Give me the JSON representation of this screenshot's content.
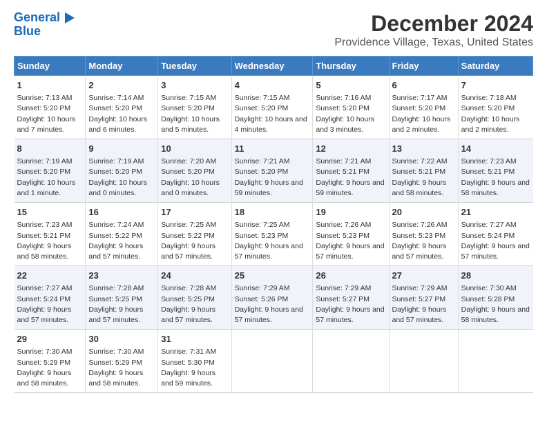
{
  "logo": {
    "line1": "General",
    "line2": "Blue"
  },
  "title": "December 2024",
  "subtitle": "Providence Village, Texas, United States",
  "days": [
    "Sunday",
    "Monday",
    "Tuesday",
    "Wednesday",
    "Thursday",
    "Friday",
    "Saturday"
  ],
  "weeks": [
    [
      {
        "day": "1",
        "sunrise": "7:13 AM",
        "sunset": "5:20 PM",
        "daylight": "10 hours and 7 minutes."
      },
      {
        "day": "2",
        "sunrise": "7:14 AM",
        "sunset": "5:20 PM",
        "daylight": "10 hours and 6 minutes."
      },
      {
        "day": "3",
        "sunrise": "7:15 AM",
        "sunset": "5:20 PM",
        "daylight": "10 hours and 5 minutes."
      },
      {
        "day": "4",
        "sunrise": "7:15 AM",
        "sunset": "5:20 PM",
        "daylight": "10 hours and 4 minutes."
      },
      {
        "day": "5",
        "sunrise": "7:16 AM",
        "sunset": "5:20 PM",
        "daylight": "10 hours and 3 minutes."
      },
      {
        "day": "6",
        "sunrise": "7:17 AM",
        "sunset": "5:20 PM",
        "daylight": "10 hours and 2 minutes."
      },
      {
        "day": "7",
        "sunrise": "7:18 AM",
        "sunset": "5:20 PM",
        "daylight": "10 hours and 2 minutes."
      }
    ],
    [
      {
        "day": "8",
        "sunrise": "7:19 AM",
        "sunset": "5:20 PM",
        "daylight": "10 hours and 1 minute."
      },
      {
        "day": "9",
        "sunrise": "7:19 AM",
        "sunset": "5:20 PM",
        "daylight": "10 hours and 0 minutes."
      },
      {
        "day": "10",
        "sunrise": "7:20 AM",
        "sunset": "5:20 PM",
        "daylight": "10 hours and 0 minutes."
      },
      {
        "day": "11",
        "sunrise": "7:21 AM",
        "sunset": "5:20 PM",
        "daylight": "9 hours and 59 minutes."
      },
      {
        "day": "12",
        "sunrise": "7:21 AM",
        "sunset": "5:21 PM",
        "daylight": "9 hours and 59 minutes."
      },
      {
        "day": "13",
        "sunrise": "7:22 AM",
        "sunset": "5:21 PM",
        "daylight": "9 hours and 58 minutes."
      },
      {
        "day": "14",
        "sunrise": "7:23 AM",
        "sunset": "5:21 PM",
        "daylight": "9 hours and 58 minutes."
      }
    ],
    [
      {
        "day": "15",
        "sunrise": "7:23 AM",
        "sunset": "5:21 PM",
        "daylight": "9 hours and 58 minutes."
      },
      {
        "day": "16",
        "sunrise": "7:24 AM",
        "sunset": "5:22 PM",
        "daylight": "9 hours and 57 minutes."
      },
      {
        "day": "17",
        "sunrise": "7:25 AM",
        "sunset": "5:22 PM",
        "daylight": "9 hours and 57 minutes."
      },
      {
        "day": "18",
        "sunrise": "7:25 AM",
        "sunset": "5:23 PM",
        "daylight": "9 hours and 57 minutes."
      },
      {
        "day": "19",
        "sunrise": "7:26 AM",
        "sunset": "5:23 PM",
        "daylight": "9 hours and 57 minutes."
      },
      {
        "day": "20",
        "sunrise": "7:26 AM",
        "sunset": "5:23 PM",
        "daylight": "9 hours and 57 minutes."
      },
      {
        "day": "21",
        "sunrise": "7:27 AM",
        "sunset": "5:24 PM",
        "daylight": "9 hours and 57 minutes."
      }
    ],
    [
      {
        "day": "22",
        "sunrise": "7:27 AM",
        "sunset": "5:24 PM",
        "daylight": "9 hours and 57 minutes."
      },
      {
        "day": "23",
        "sunrise": "7:28 AM",
        "sunset": "5:25 PM",
        "daylight": "9 hours and 57 minutes."
      },
      {
        "day": "24",
        "sunrise": "7:28 AM",
        "sunset": "5:25 PM",
        "daylight": "9 hours and 57 minutes."
      },
      {
        "day": "25",
        "sunrise": "7:29 AM",
        "sunset": "5:26 PM",
        "daylight": "9 hours and 57 minutes."
      },
      {
        "day": "26",
        "sunrise": "7:29 AM",
        "sunset": "5:27 PM",
        "daylight": "9 hours and 57 minutes."
      },
      {
        "day": "27",
        "sunrise": "7:29 AM",
        "sunset": "5:27 PM",
        "daylight": "9 hours and 57 minutes."
      },
      {
        "day": "28",
        "sunrise": "7:30 AM",
        "sunset": "5:28 PM",
        "daylight": "9 hours and 58 minutes."
      }
    ],
    [
      {
        "day": "29",
        "sunrise": "7:30 AM",
        "sunset": "5:29 PM",
        "daylight": "9 hours and 58 minutes."
      },
      {
        "day": "30",
        "sunrise": "7:30 AM",
        "sunset": "5:29 PM",
        "daylight": "9 hours and 58 minutes."
      },
      {
        "day": "31",
        "sunrise": "7:31 AM",
        "sunset": "5:30 PM",
        "daylight": "9 hours and 59 minutes."
      },
      null,
      null,
      null,
      null
    ]
  ],
  "labels": {
    "sunrise": "Sunrise:",
    "sunset": "Sunset:",
    "daylight": "Daylight hours"
  }
}
